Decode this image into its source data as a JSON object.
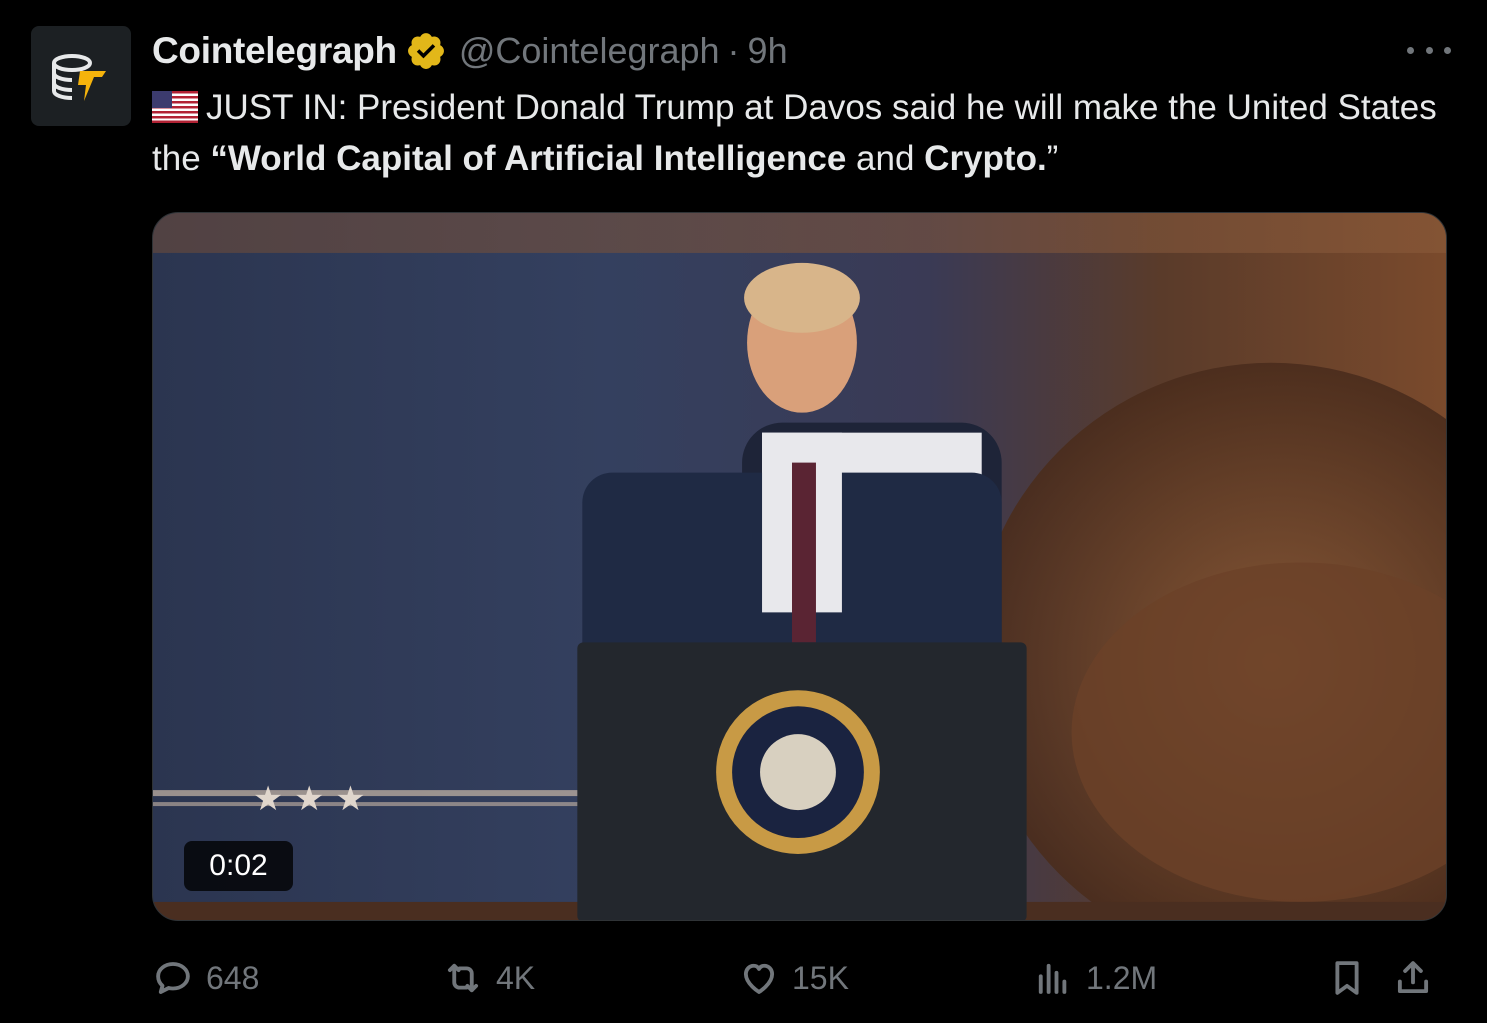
{
  "tweet": {
    "display_name": "Cointelegraph",
    "handle": "@Cointelegraph",
    "separator": "·",
    "time": "9h",
    "flag_icon": "us-flag-icon",
    "text_parts": {
      "p1": "JUST IN: President Donald Trump at Davos said he will make the United States the ",
      "b1": "“World Capital of Artificial Intelligence",
      "p2": " and ",
      "b2": "Crypto.",
      "p3": "”"
    },
    "media": {
      "duration": "0:02"
    }
  },
  "actions": {
    "replies": "648",
    "reposts": "4K",
    "likes": "15K",
    "views": "1.2M"
  },
  "colors": {
    "background": "#000000",
    "text_primary": "#e7e9ea",
    "text_secondary": "#71767b",
    "verified_badge": "#e2b719",
    "brand_accent": "#f5b30c"
  }
}
